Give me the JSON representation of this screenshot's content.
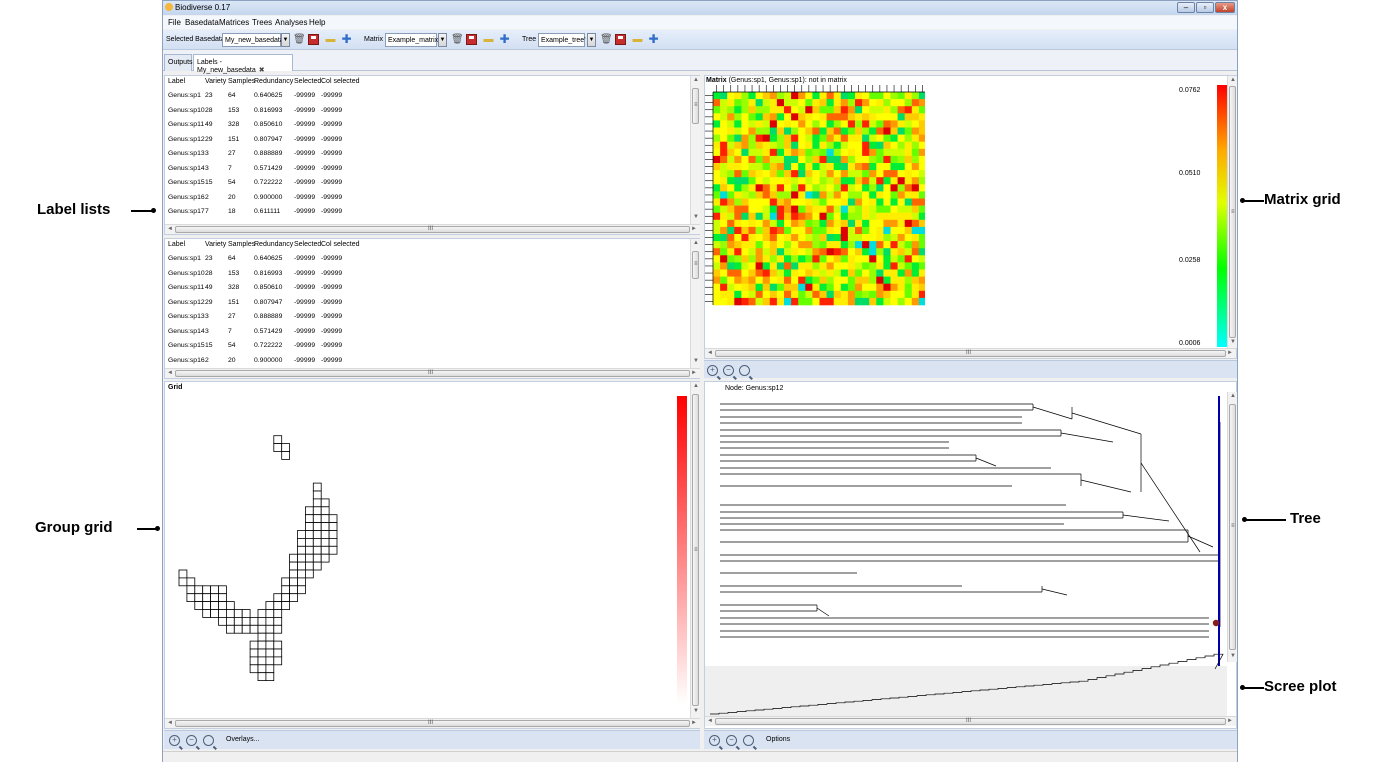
{
  "window": {
    "title": "Biodiverse 0.17"
  },
  "menu": [
    "File",
    "Basedata",
    "Matrices",
    "Trees",
    "Analyses",
    "Help"
  ],
  "toolbar": {
    "basedata_label": "Selected Basedata",
    "basedata_value": "My_new_basedata",
    "matrix_label": "Matrix",
    "matrix_value": "Example_matrix",
    "tree_label": "Tree",
    "tree_value": "Example_tree'"
  },
  "tabs": [
    {
      "label": "Outputs",
      "active": false
    },
    {
      "label": "Labels - My_new_basedata",
      "active": true
    }
  ],
  "label_list": {
    "columns": [
      "Label",
      "Variety",
      "Samples",
      "Redundancy",
      "Selected",
      "Col selected"
    ],
    "rows_top": [
      [
        "Genus:sp1",
        "23",
        "64",
        "0.640625",
        "-99999",
        "-99999"
      ],
      [
        "Genus:sp10",
        "28",
        "153",
        "0.816993",
        "-99999",
        "-99999"
      ],
      [
        "Genus:sp11",
        "49",
        "328",
        "0.850610",
        "-99999",
        "-99999"
      ],
      [
        "Genus:sp12",
        "29",
        "151",
        "0.807947",
        "-99999",
        "-99999"
      ],
      [
        "Genus:sp13",
        "3",
        "27",
        "0.888889",
        "-99999",
        "-99999"
      ],
      [
        "Genus:sp14",
        "3",
        "7",
        "0.571429",
        "-99999",
        "-99999"
      ],
      [
        "Genus:sp15",
        "15",
        "54",
        "0.722222",
        "-99999",
        "-99999"
      ],
      [
        "Genus:sp16",
        "2",
        "20",
        "0.900000",
        "-99999",
        "-99999"
      ],
      [
        "Genus:sp17",
        "7",
        "18",
        "0.611111",
        "-99999",
        "-99999"
      ]
    ],
    "rows_bottom": [
      [
        "Genus:sp1",
        "23",
        "64",
        "0.640625",
        "-99999",
        "-99999"
      ],
      [
        "Genus:sp10",
        "28",
        "153",
        "0.816993",
        "-99999",
        "-99999"
      ],
      [
        "Genus:sp11",
        "49",
        "328",
        "0.850610",
        "-99999",
        "-99999"
      ],
      [
        "Genus:sp12",
        "29",
        "151",
        "0.807947",
        "-99999",
        "-99999"
      ],
      [
        "Genus:sp13",
        "3",
        "27",
        "0.888889",
        "-99999",
        "-99999"
      ],
      [
        "Genus:sp14",
        "3",
        "7",
        "0.571429",
        "-99999",
        "-99999"
      ],
      [
        "Genus:sp15",
        "15",
        "54",
        "0.722222",
        "-99999",
        "-99999"
      ],
      [
        "Genus:sp16",
        "2",
        "20",
        "0.900000",
        "-99999",
        "-99999"
      ]
    ]
  },
  "matrix": {
    "title_bold": "Matrix",
    "title_rest": "(Genus:sp1, Genus:sp1): not in matrix",
    "legend": [
      "0.0762",
      "0.0510",
      "0.0258",
      "0.0006"
    ]
  },
  "grid": {
    "title": "Grid",
    "overlays_label": "Overlays..."
  },
  "tree": {
    "node_label": "Node: Genus:sp12",
    "options_label": "Options"
  },
  "callouts": {
    "label_lists": "Label lists",
    "group_grid": "Group grid",
    "matrix_grid": "Matrix grid",
    "tree": "Tree",
    "scree_plot": "Scree plot"
  },
  "icons": [
    "app-icon",
    "delete-icon",
    "save-icon",
    "open-folder-icon",
    "add-icon",
    "zoom-in-icon",
    "zoom-out-icon",
    "zoom-fit-icon",
    "tab-close-icon"
  ]
}
